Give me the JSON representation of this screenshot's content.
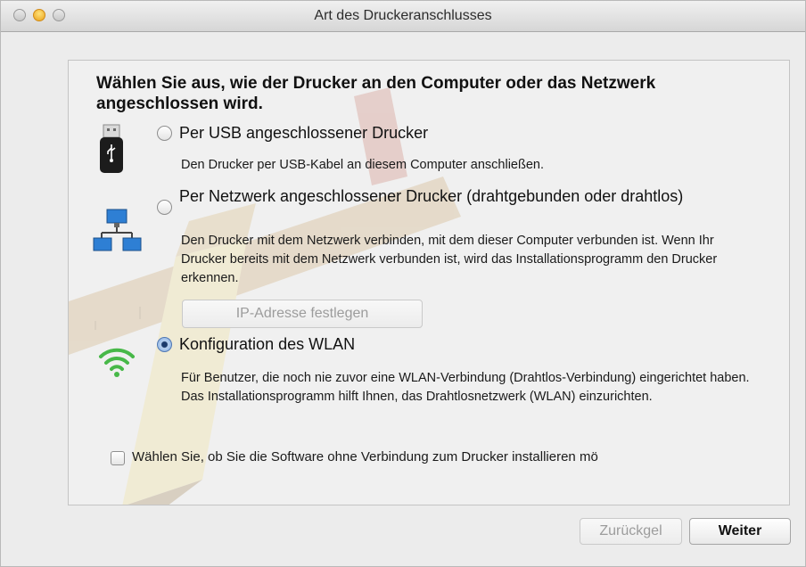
{
  "window": {
    "title": "Art des Druckeranschlusses"
  },
  "heading": "Wählen Sie aus, wie der Drucker an den Computer oder das Netzwerk angeschlossen wird.",
  "options": [
    {
      "label": "Per USB angeschlossener Drucker",
      "description": "Den Drucker per USB-Kabel an diesem Computer anschließen.",
      "selected": false,
      "icon": "usb-icon"
    },
    {
      "label": "Per Netzwerk angeschlossener Drucker (drahtgebunden oder drahtlos)",
      "description": "Den Drucker mit dem Netzwerk verbinden, mit dem dieser Computer verbunden ist. Wenn Ihr Drucker bereits mit dem Netzwerk verbunden ist, wird das Installationsprogramm den Drucker erkennen.",
      "selected": false,
      "icon": "network-icon"
    },
    {
      "label": "Konfiguration des WLAN",
      "description": "Für Benutzer, die noch nie zuvor eine WLAN-Verbindung (Drahtlos-Verbindung) eingerichtet haben. Das Installationsprogramm hilft Ihnen, das Drahtlosnetzwerk (WLAN) einzurichten.",
      "selected": true,
      "icon": "wifi-icon"
    }
  ],
  "ip_button": "IP-Adresse festlegen",
  "checkbox": {
    "label": "Wählen Sie, ob Sie die Software ohne Verbindung zum Drucker installieren mö",
    "checked": false
  },
  "footer": {
    "back_label": "Zurückgel",
    "next_label": "Weiter"
  }
}
